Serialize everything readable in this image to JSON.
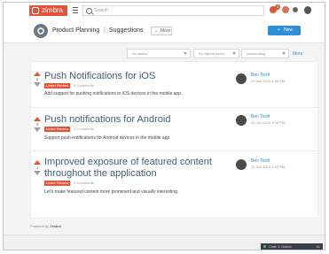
{
  "topbar": {
    "logo_text": "zimbra",
    "search_placeholder": "Search",
    "badge_count": "3"
  },
  "header": {
    "app_name": "Product Planning",
    "separator": "|",
    "section": "Suggestions",
    "more_label": "More",
    "new_label": "New"
  },
  "filters": {
    "status": "No status",
    "sort": "By highest score",
    "order": "Descending",
    "more_link": "More"
  },
  "posts": [
    {
      "votes": "3",
      "title": "Push Notifications for iOS",
      "status": "Under Review",
      "comments": "0 Comments",
      "description": "Add support for pushing notifications to iOS devices in the mobile app.",
      "author": "Ben Tiedt",
      "date": "23 Jan 2014 4:30 PM"
    },
    {
      "votes": "3",
      "title": "Push notifications for Android",
      "status": "Under Review",
      "comments": "0 Comments",
      "description": "Support push-notifications for Android devices in the mobile app.",
      "author": "Ben Tiedt",
      "date": "23 Jan 2014 4:30 PM"
    },
    {
      "votes": "-1",
      "title": "Improved exposure of featured content throughout the application",
      "status": "Under Review",
      "comments": "0 Comments",
      "description": "Let's make featured content more prominent and visually interesting.",
      "author": "Ben Tiedt",
      "date": "23 Jan 2014 4:32 PM"
    }
  ],
  "footer": {
    "powered_by": "Powered by",
    "brand": "Zimbra",
    "chat_label": "Chat: 1 Online",
    "chat_count": "41"
  },
  "icons": {
    "search": "search-icon",
    "menu": "hamburger-icon",
    "vote_up": "vote-up-icon",
    "vote_down": "vote-down-icon"
  },
  "colors": {
    "accent": "#e2543a",
    "primary": "#2f8fd8",
    "title": "#3f5f7a"
  }
}
